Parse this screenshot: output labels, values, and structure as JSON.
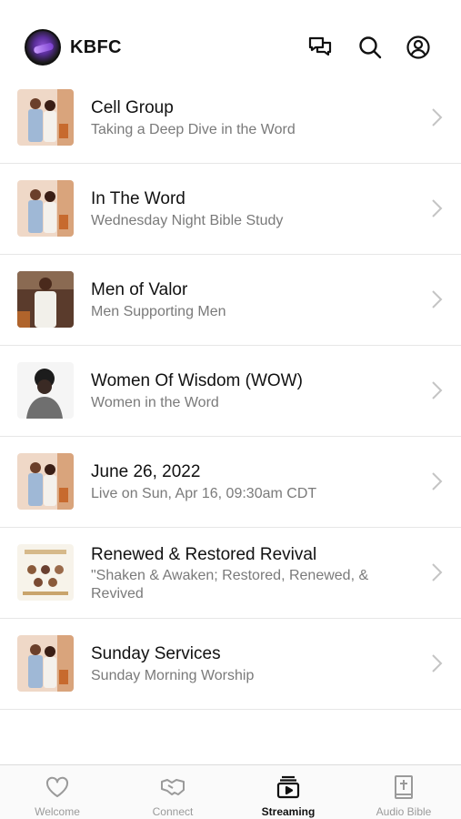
{
  "header": {
    "title": "KBFC"
  },
  "items": [
    {
      "title": "Cell Group",
      "subtitle": "Taking a Deep Dive in the Word"
    },
    {
      "title": "In The Word",
      "subtitle": "Wednesday Night Bible Study"
    },
    {
      "title": "Men of Valor",
      "subtitle": "Men Supporting Men"
    },
    {
      "title": "Women Of Wisdom (WOW)",
      "subtitle": "Women in the Word"
    },
    {
      "title": "June 26, 2022",
      "subtitle": "Live on Sun, Apr 16, 09:30am CDT"
    },
    {
      "title": "Renewed & Restored Revival",
      "subtitle": "\"Shaken & Awaken; Restored, Renewed, & Revived"
    },
    {
      "title": "Sunday Services",
      "subtitle": "Sunday Morning Worship"
    }
  ],
  "tabs": [
    {
      "label": "Welcome",
      "icon": "heart-icon"
    },
    {
      "label": "Connect",
      "icon": "handshake-icon"
    },
    {
      "label": "Streaming",
      "icon": "play-stack-icon",
      "active": true
    },
    {
      "label": "Audio Bible",
      "icon": "bible-icon"
    }
  ]
}
